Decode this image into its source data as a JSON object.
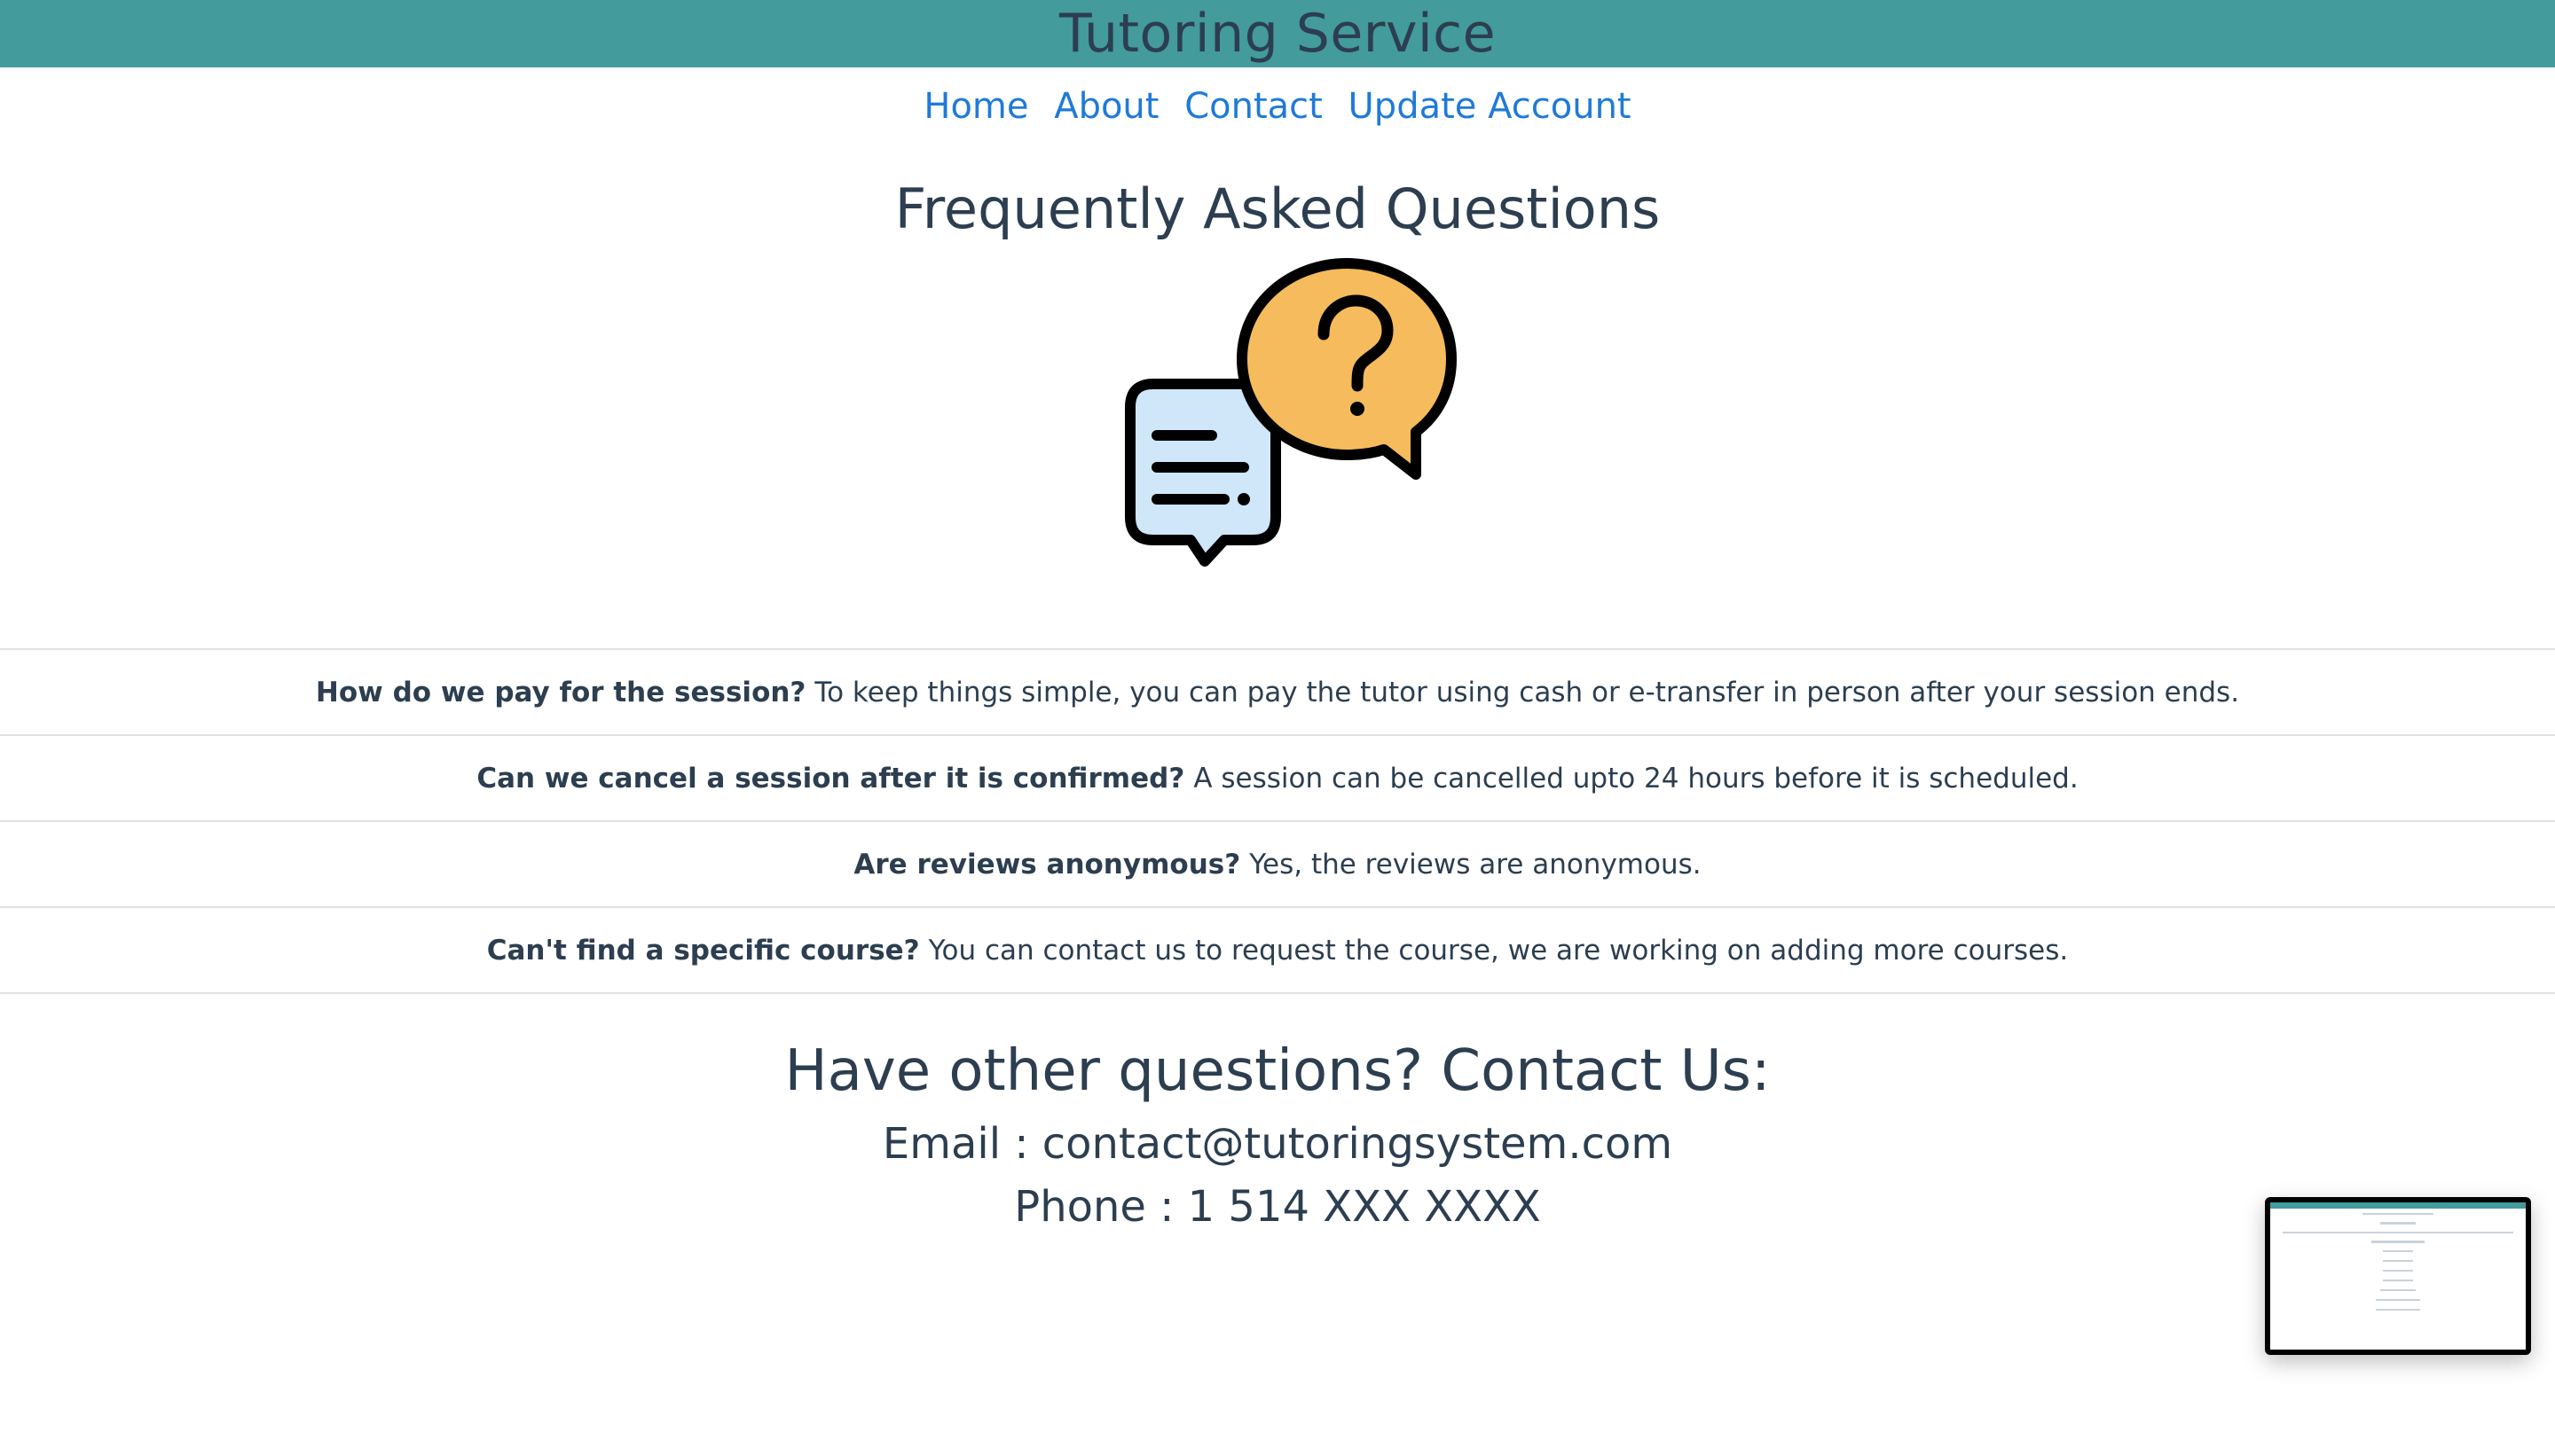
{
  "header": {
    "title": "Tutoring Service"
  },
  "nav": {
    "items": [
      {
        "label": "Home"
      },
      {
        "label": "About"
      },
      {
        "label": "Contact"
      },
      {
        "label": "Update Account"
      }
    ]
  },
  "faq": {
    "title": "Frequently Asked Questions",
    "illustration_icon": "chat-question-icon",
    "colors": {
      "bubble_blue": "#cfe7f9",
      "bubble_orange": "#f5bb5c",
      "outline": "#000000"
    },
    "items": [
      {
        "question": "How do we pay for the session?",
        "answer": "To keep things simple, you can pay the tutor using cash or e-transfer in person after your session ends."
      },
      {
        "question": "Can we cancel a session after it is confirmed?",
        "answer": "A session can be cancelled upto 24 hours before it is scheduled."
      },
      {
        "question": "Are reviews anonymous?",
        "answer": "Yes, the reviews are anonymous."
      },
      {
        "question": "Can't find a specific course?",
        "answer": "You can contact us to request the course, we are working on adding more courses."
      }
    ]
  },
  "contact": {
    "heading": "Have other questions? Contact Us:",
    "email_line": "Email : contact@tutoringsystem.com",
    "phone_line": "Phone : 1 514 XXX XXXX"
  },
  "theme": {
    "header_bg": "#439b9b",
    "link_color": "#1f7ad8",
    "text_color": "#2c3e50"
  }
}
